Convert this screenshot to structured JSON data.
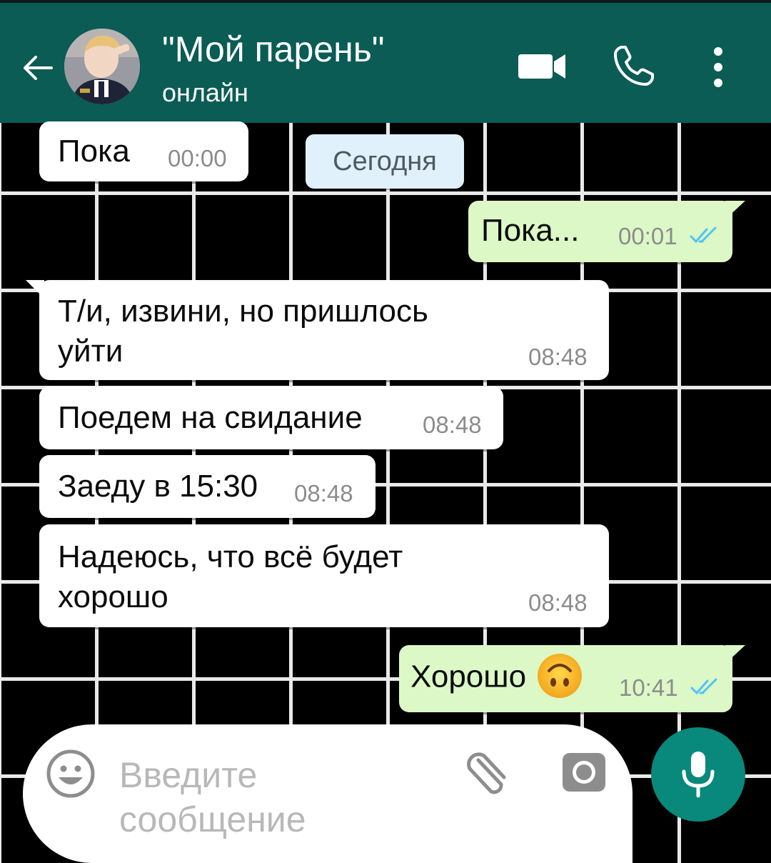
{
  "header": {
    "title": "\"Мой парень\"",
    "status": "онлайн",
    "colors": {
      "bar": "#0a5c55",
      "text": "#ffffff"
    },
    "icons": [
      "back-arrow-icon",
      "avatar",
      "video-call-icon",
      "phone-icon",
      "more-vert-icon"
    ]
  },
  "chat": {
    "date_divider": "Сегодня",
    "messages": [
      {
        "direction": "in",
        "text": "Пока",
        "time": "00:00"
      },
      {
        "direction": "out",
        "text": "Пока...",
        "time": "00:01",
        "status": "read"
      },
      {
        "direction": "in",
        "text_line1": "Т/и, извини, но пришлось",
        "text_line2": "уйти",
        "time": "08:48"
      },
      {
        "direction": "in",
        "text": "Поедем на свидание",
        "time": "08:48"
      },
      {
        "direction": "in",
        "text": "Заеду в 15:30",
        "time": "08:48"
      },
      {
        "direction": "in",
        "text_line1": "Надеюсь, что всё будет",
        "text_line2": "хорошо",
        "time": "08:48"
      },
      {
        "direction": "out",
        "text": "Хорошо",
        "emoji": "upside-down-face-emoji",
        "time": "10:41",
        "status": "read"
      }
    ],
    "colors": {
      "incoming": "#ffffff",
      "outgoing": "#dcf8c6",
      "read_ticks": "#4fc3f7"
    }
  },
  "composer": {
    "placeholder": "Введите\nсообщение",
    "icons": [
      "emoji-icon",
      "attach-icon",
      "camera-icon",
      "mic-icon"
    ],
    "colors": {
      "mic_button": "#09897b"
    }
  }
}
